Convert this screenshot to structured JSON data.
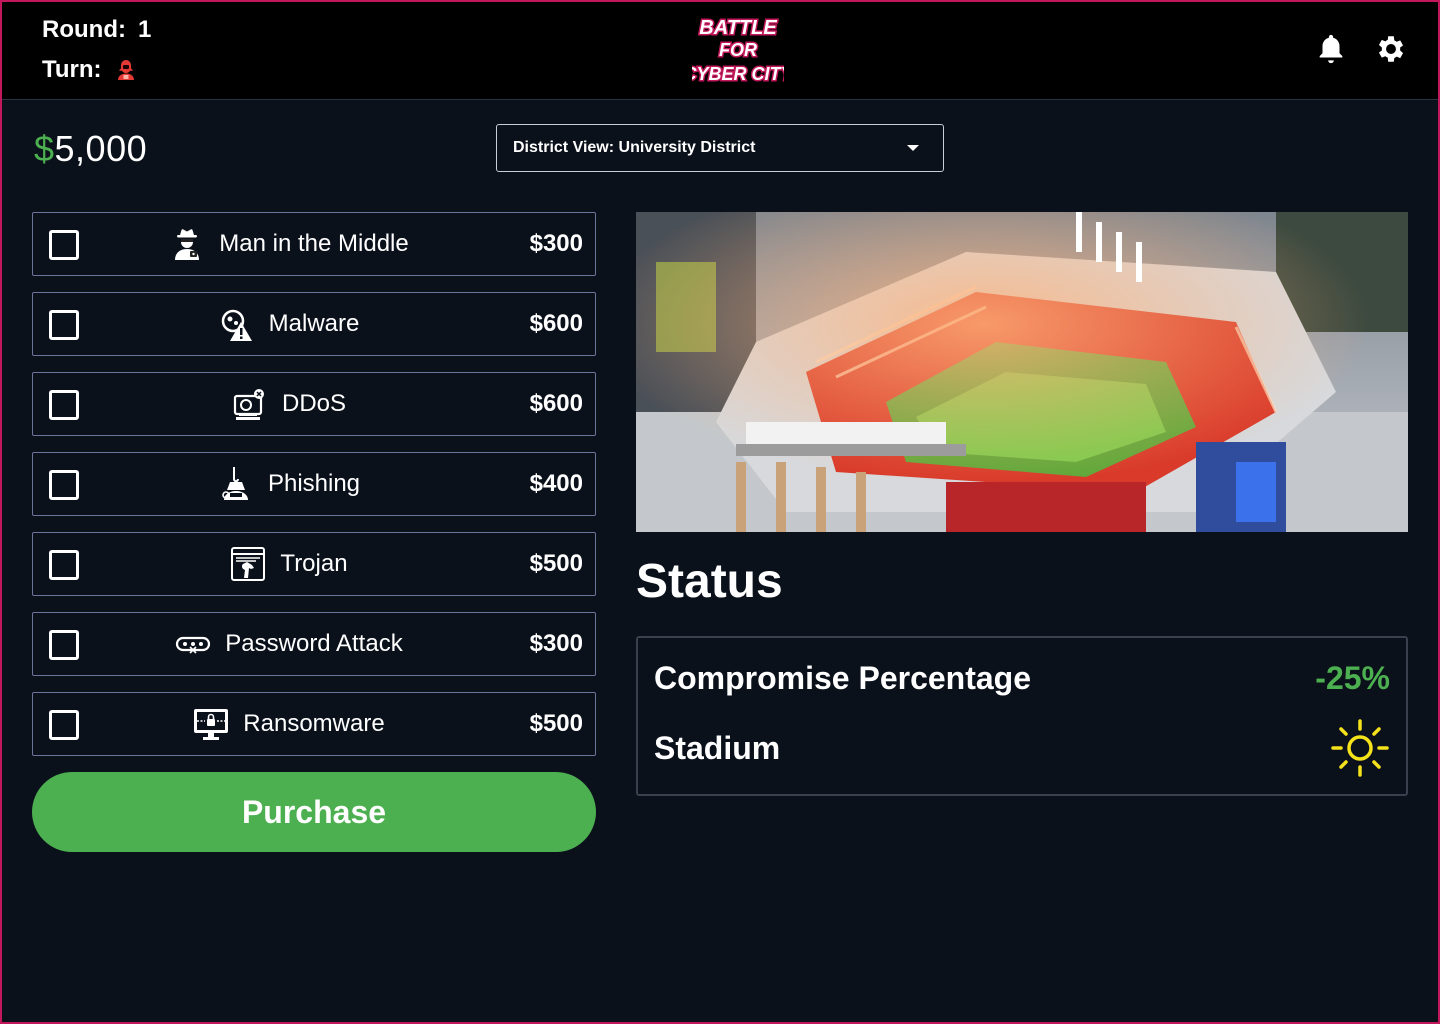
{
  "header": {
    "round_label": "Round:",
    "round_value": "1",
    "turn_label": "Turn:",
    "turn_icon": "red-hacker-icon",
    "logo_lines": [
      "BATTLE",
      "FOR",
      "CYBER CITY"
    ],
    "icons": [
      "bell-icon",
      "gear-icon"
    ]
  },
  "money": {
    "symbol": "$",
    "amount": "5,000"
  },
  "district": {
    "label": "District View: University  District"
  },
  "attacks": [
    {
      "name": "Man in the Middle",
      "price": "$300",
      "icon": "spy-icon",
      "checked": false
    },
    {
      "name": "Malware",
      "price": "$600",
      "icon": "malware-warning-icon",
      "checked": false
    },
    {
      "name": "DDoS",
      "price": "$600",
      "icon": "ddos-computer-icon",
      "checked": false
    },
    {
      "name": "Phishing",
      "price": "$400",
      "icon": "phishing-hook-icon",
      "checked": false
    },
    {
      "name": "Trojan",
      "price": "$500",
      "icon": "trojan-horse-icon",
      "checked": false
    },
    {
      "name": "Password Attack",
      "price": "$300",
      "icon": "password-key-icon",
      "checked": false
    },
    {
      "name": "Ransomware",
      "price": "$500",
      "icon": "ransomware-lock-icon",
      "checked": false
    }
  ],
  "purchase_label": "Purchase",
  "status": {
    "title": "Status",
    "compromise_label": "Compromise Percentage",
    "compromise_value": "-25%",
    "location_label": "Stadium",
    "location_icon": "sun-icon"
  },
  "colors": {
    "accent_green": "#4caf50",
    "background": "#0b111b",
    "frame_border": "#c2185b",
    "sun_yellow": "#f5e21b"
  }
}
